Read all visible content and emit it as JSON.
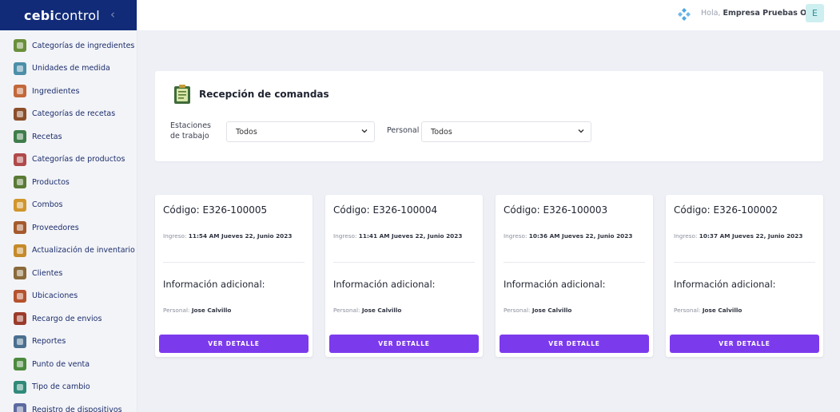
{
  "brand": {
    "logo_bold": "ebi",
    "logo_rest": "control",
    "logo_prefix": "c"
  },
  "sidebar": {
    "items": [
      {
        "label": "Categorías de ingredientes",
        "icon": "ingredient-categories-icon",
        "color": "#6a8f3a"
      },
      {
        "label": "Unidades de medida",
        "icon": "measure-units-icon",
        "color": "#4c8fa8"
      },
      {
        "label": "Ingredientes",
        "icon": "ingredients-icon",
        "color": "#c2683a"
      },
      {
        "label": "Categorías de recetas",
        "icon": "recipe-categories-icon",
        "color": "#8b4f2a"
      },
      {
        "label": "Recetas",
        "icon": "recipes-icon",
        "color": "#3f7d4a"
      },
      {
        "label": "Categorías de productos",
        "icon": "product-categories-icon",
        "color": "#b04a4a"
      },
      {
        "label": "Productos",
        "icon": "products-icon",
        "color": "#5a7a35"
      },
      {
        "label": "Combos",
        "icon": "combos-icon",
        "color": "#d1962d"
      },
      {
        "label": "Proveedores",
        "icon": "suppliers-icon",
        "color": "#a45a2e"
      },
      {
        "label": "Actualización de inventario",
        "icon": "inventory-update-icon",
        "color": "#c58a2a"
      },
      {
        "label": "Clientes",
        "icon": "clients-icon",
        "color": "#8a6a3a"
      },
      {
        "label": "Ubicaciones",
        "icon": "locations-icon",
        "color": "#b5532f"
      },
      {
        "label": "Recargo de envios",
        "icon": "shipping-surcharge-icon",
        "color": "#9b3b2b"
      },
      {
        "label": "Reportes",
        "icon": "reports-icon",
        "color": "#4a6f8f"
      },
      {
        "label": "Punto de venta",
        "icon": "point-of-sale-icon",
        "color": "#4b8a3e"
      },
      {
        "label": "Tipo de cambio",
        "icon": "exchange-rate-icon",
        "color": "#2f8a7a"
      },
      {
        "label": "Registro de dispositivos",
        "icon": "device-register-icon",
        "color": "#5b6aa0"
      }
    ]
  },
  "topbar": {
    "greeting_prefix": "Hola,",
    "user_name": "Empresa Pruebas Omar",
    "avatar_initial": "E"
  },
  "filters": {
    "title": "Recepción de comandas",
    "estaciones_label": "Estaciones de trabajo",
    "estaciones_value": "Todos",
    "personal_label": "Personal",
    "personal_value": "Todos"
  },
  "orders": [
    {
      "code": "Código: E326-100005",
      "ingreso_label": "Ingreso:",
      "ingreso_value": "11:54 AM Jueves 22, Junio 2023",
      "info_title": "Información adicional:",
      "personal_label": "Personal:",
      "personal_value": "Jose Calvillo",
      "button": "VER DETALLE"
    },
    {
      "code": "Código: E326-100004",
      "ingreso_label": "Ingreso:",
      "ingreso_value": "11:41 AM Jueves 22, Junio 2023",
      "info_title": "Información adicional:",
      "personal_label": "Personal:",
      "personal_value": "Jose Calvillo",
      "button": "VER DETALLE"
    },
    {
      "code": "Código: E326-100003",
      "ingreso_label": "Ingreso:",
      "ingreso_value": "10:36 AM Jueves 22, Junio 2023",
      "info_title": "Información adicional:",
      "personal_label": "Personal:",
      "personal_value": "Jose Calvillo",
      "button": "VER DETALLE"
    },
    {
      "code": "Código: E326-100002",
      "ingreso_label": "Ingreso:",
      "ingreso_value": "10:37 AM Jueves 22, Junio 2023",
      "info_title": "Información adicional:",
      "personal_label": "Personal:",
      "personal_value": "Jose Calvillo",
      "button": "VER DETALLE"
    }
  ],
  "colors": {
    "brand": "#112b78",
    "accent": "#7c3aed",
    "background": "#eef0f6",
    "avatar_bg": "#cdeff0"
  }
}
